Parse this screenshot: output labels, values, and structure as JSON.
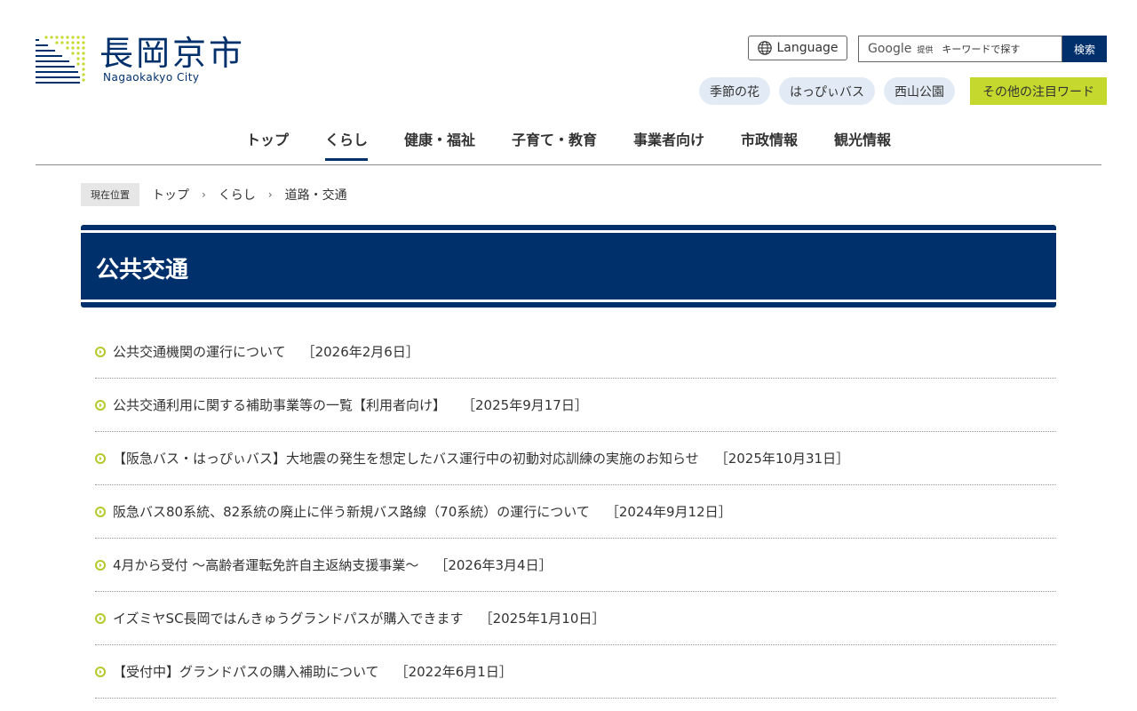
{
  "header": {
    "logo_text": "長岡京市",
    "logo_sub": "Nagaokakyo City",
    "language_label": "Language",
    "search_brand": "Google",
    "search_provided": "提供",
    "search_placeholder": "キーワードで探す",
    "search_button": "検索",
    "tags": [
      "季節の花",
      "はっぴぃバス",
      "西山公園"
    ],
    "more_tags": "その他の注目ワード"
  },
  "nav": {
    "items": [
      "トップ",
      "くらし",
      "健康・福祉",
      "子育て・教育",
      "事業者向け",
      "市政情報",
      "観光情報"
    ],
    "active": "くらし"
  },
  "breadcrumb": {
    "here_label": "現在位置",
    "items": [
      "トップ",
      "くらし",
      "道路・交通"
    ],
    "separator": "›"
  },
  "page": {
    "title": "公共交通"
  },
  "colors": {
    "primary": "#00306b",
    "accent": "#c4d82d",
    "tag_bg": "#e2ebf5"
  },
  "articles": [
    {
      "title": "公共交通機関の運行について",
      "date": "［2026年2月6日］"
    },
    {
      "title": "公共交通利用に関する補助事業等の一覧【利用者向け】",
      "date": "［2025年9月17日］"
    },
    {
      "title": "【阪急バス・はっぴぃバス】大地震の発生を想定したバス運行中の初動対応訓練の実施のお知らせ",
      "date": "［2025年10月31日］"
    },
    {
      "title": "阪急バス80系統、82系統の廃止に伴う新規バス路線（70系統）の運行について",
      "date": "［2024年9月12日］"
    },
    {
      "title": "4月から受付 ～高齢者運転免許自主返納支援事業～",
      "date": "［2026年3月4日］"
    },
    {
      "title": "イズミヤSC長岡ではんきゅうグランドパスが購入できます",
      "date": "［2025年1月10日］"
    },
    {
      "title": "【受付中】グランドパスの購入補助について",
      "date": "［2022年6月1日］"
    }
  ]
}
